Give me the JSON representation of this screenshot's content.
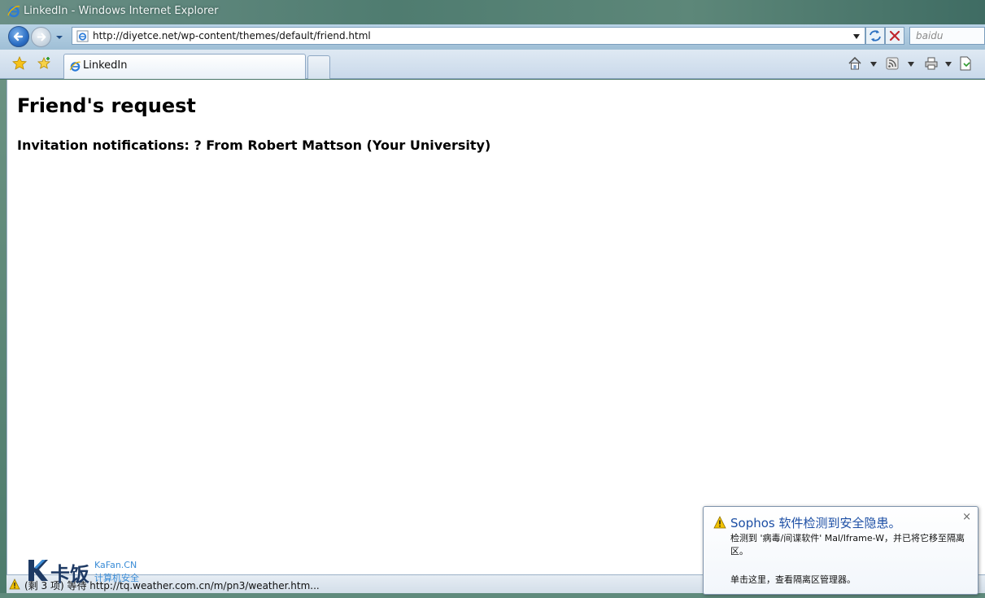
{
  "window": {
    "title": "LinkedIn - Windows Internet Explorer"
  },
  "navigation": {
    "address": "http://diyetce.net/wp-content/themes/default/friend.html",
    "search_placeholder": "baidu"
  },
  "tabs": [
    {
      "label": "LinkedIn",
      "active": true
    }
  ],
  "command_bar": {
    "icons": [
      "home-icon",
      "feeds-icon",
      "print-icon",
      "page-icon"
    ]
  },
  "page": {
    "heading": "Friend's request",
    "subheading": "Invitation notifications: ? From Robert Mattson (Your University)"
  },
  "status_bar": {
    "text": "(剩 3 项) 等待 http://tq.weather.com.cn/m/pn3/weather.htm..."
  },
  "watermark": {
    "logo_cn": "卡饭",
    "logo_en": "KaFan.CN",
    "subtitle": "计算机安全"
  },
  "popup": {
    "title": "Sophos 软件检测到安全隐患。",
    "body": "检测到 '病毒/间谍软件' Mal/Iframe-W，并已将它移至隔离区。",
    "link": "单击这里，查看隔离区管理器。",
    "close": "×"
  },
  "colors": {
    "accent_blue": "#1d4fa5",
    "warning_yellow": "#f2c200",
    "stop_red": "#c0262d"
  }
}
